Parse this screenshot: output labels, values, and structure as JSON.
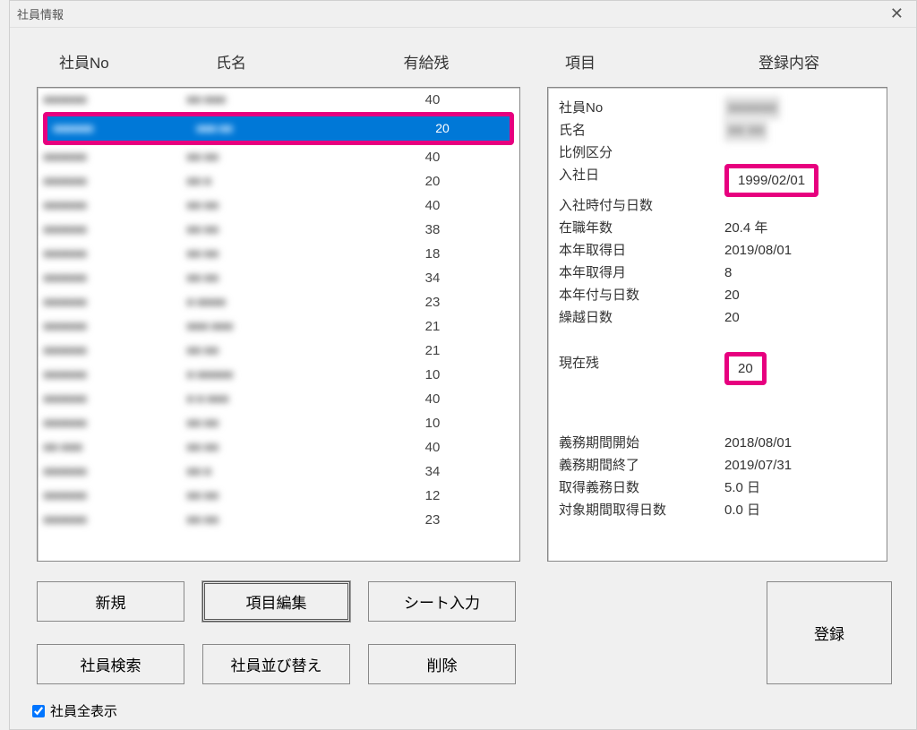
{
  "window": {
    "title": "社員情報"
  },
  "columns": {
    "left": {
      "c1": "社員No",
      "c2": "氏名",
      "c3": "有給残"
    },
    "right": {
      "c1": "項目",
      "c2": "登録内容"
    }
  },
  "listRows": [
    {
      "no": "■■■■■■",
      "name": "■■ ■■■",
      "paid": "40",
      "selected": false
    },
    {
      "no": "■■■■■■",
      "name": "■■■ ■■",
      "paid": "20",
      "selected": true
    },
    {
      "no": "■■■■■■",
      "name": "■■ ■■",
      "paid": "40",
      "selected": false
    },
    {
      "no": "■■■■■■",
      "name": "■■ ■",
      "paid": "20",
      "selected": false
    },
    {
      "no": "■■■■■■",
      "name": "■■ ■■",
      "paid": "40",
      "selected": false
    },
    {
      "no": "■■■■■■",
      "name": "■■ ■■",
      "paid": "38",
      "selected": false
    },
    {
      "no": "■■■■■■",
      "name": "■■ ■■",
      "paid": "18",
      "selected": false
    },
    {
      "no": "■■■■■■",
      "name": "■■ ■■",
      "paid": "34",
      "selected": false
    },
    {
      "no": "■■■■■■",
      "name": "■ ■■■■",
      "paid": "23",
      "selected": false
    },
    {
      "no": "■■■■■■",
      "name": "■■■ ■■■",
      "paid": "21",
      "selected": false
    },
    {
      "no": "■■■■■■",
      "name": "■■ ■■",
      "paid": "21",
      "selected": false
    },
    {
      "no": "■■■■■■",
      "name": "■ ■■■■■",
      "paid": "10",
      "selected": false
    },
    {
      "no": "■■■■■■",
      "name": "■ ■ ■■■",
      "paid": "40",
      "selected": false
    },
    {
      "no": "■■■■■■",
      "name": "■■ ■■",
      "paid": "10",
      "selected": false
    },
    {
      "no": "■■ ■■■",
      "name": "■■ ■■",
      "paid": "40",
      "selected": false
    },
    {
      "no": "■■■■■■",
      "name": "■■ ■",
      "paid": "34",
      "selected": false
    },
    {
      "no": "■■■■■■",
      "name": "■■ ■■",
      "paid": "12",
      "selected": false
    },
    {
      "no": "■■■■■■",
      "name": "■■ ■■",
      "paid": "23",
      "selected": false
    }
  ],
  "details": {
    "emp_no_label": "社員No",
    "emp_no_value": "■■■■■■",
    "name_label": "氏名",
    "name_value": "■■ ■■",
    "prop_label": "比例区分",
    "prop_value": "",
    "hired_label": "入社日",
    "hired_value": "1999/02/01",
    "hireddays_label": "入社時付与日数",
    "hireddays_value": "",
    "years_label": "在職年数",
    "years_value": "20.4 年",
    "acqdate_label": "本年取得日",
    "acqdate_value": "2019/08/01",
    "acqmonth_label": "本年取得月",
    "acqmonth_value": "8",
    "granted_label": "本年付与日数",
    "granted_value": "20",
    "carryover_label": "繰越日数",
    "carryover_value": "20",
    "remain_label": "現在残",
    "remain_value": "20",
    "dutystart_label": "義務期間開始",
    "dutystart_value": "2018/08/01",
    "dutyend_label": "義務期間終了",
    "dutyend_value": "2019/07/31",
    "dutydays_label": "取得義務日数",
    "dutydays_value": "5.0 日",
    "takendays_label": "対象期間取得日数",
    "takendays_value": "0.0 日"
  },
  "buttons": {
    "new": "新規",
    "itemedit": "項目編集",
    "sheet": "シート入力",
    "search": "社員検索",
    "sort": "社員並び替え",
    "delete": "削除",
    "register": "登録"
  },
  "showAllLabel": "社員全表示"
}
